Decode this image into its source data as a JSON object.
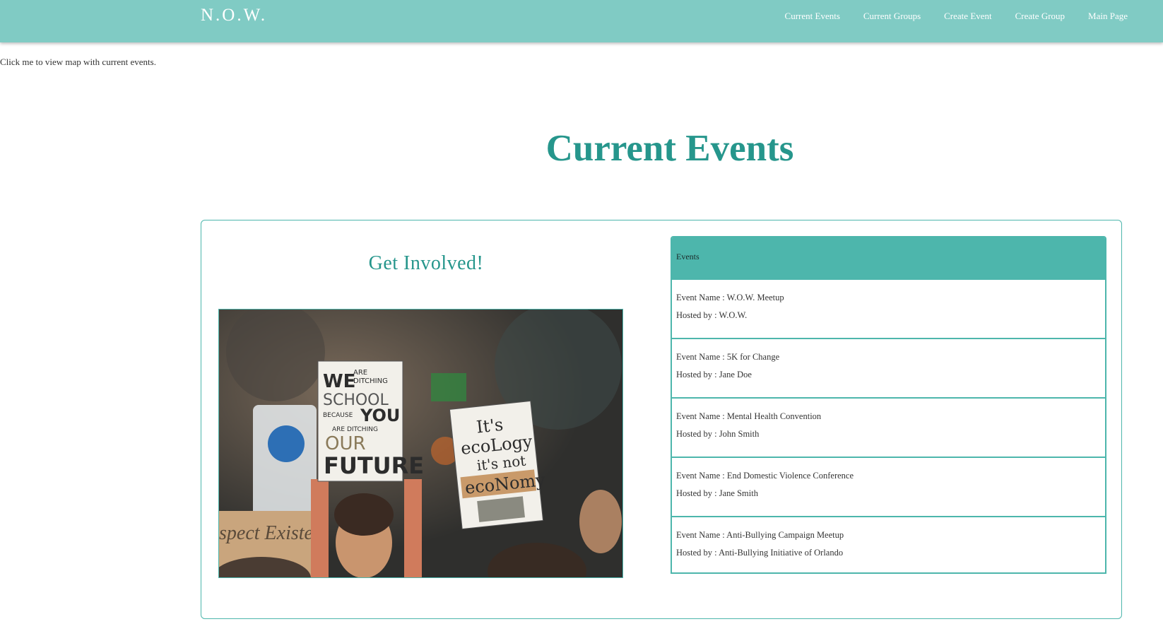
{
  "navbar": {
    "brand": "N.O.W.",
    "links": [
      "Current Events",
      "Current Groups",
      "Create Event",
      "Create Group",
      "Main Page"
    ],
    "background_color": "#80cbc4"
  },
  "map_link": "Click me to view map with current events.",
  "page_title": "Current Events",
  "card": {
    "subtitle": "Get Involved!",
    "accent_color": "#4db6ac",
    "hero_image": {
      "signs": [
        "WE ARE DITCHING SCHOOL BECAUSE YOU ARE DITCHING OUR FUTURE",
        "It's ecoLogy it's not ecoNomy",
        "spect Existen"
      ]
    }
  },
  "events": {
    "header": "Events",
    "name_prefix": "Event Name : ",
    "host_prefix": "Hosted by : ",
    "items": [
      {
        "name": "W.O.W. Meetup",
        "host": "W.O.W."
      },
      {
        "name": "5K for Change",
        "host": "Jane Doe"
      },
      {
        "name": "Mental Health Convention",
        "host": "John Smith"
      },
      {
        "name": "End Domestic Violence Conference",
        "host": "Jane Smith"
      },
      {
        "name": "Anti-Bullying Campaign Meetup",
        "host": "Anti-Bullying Initiative of Orlando"
      }
    ]
  }
}
